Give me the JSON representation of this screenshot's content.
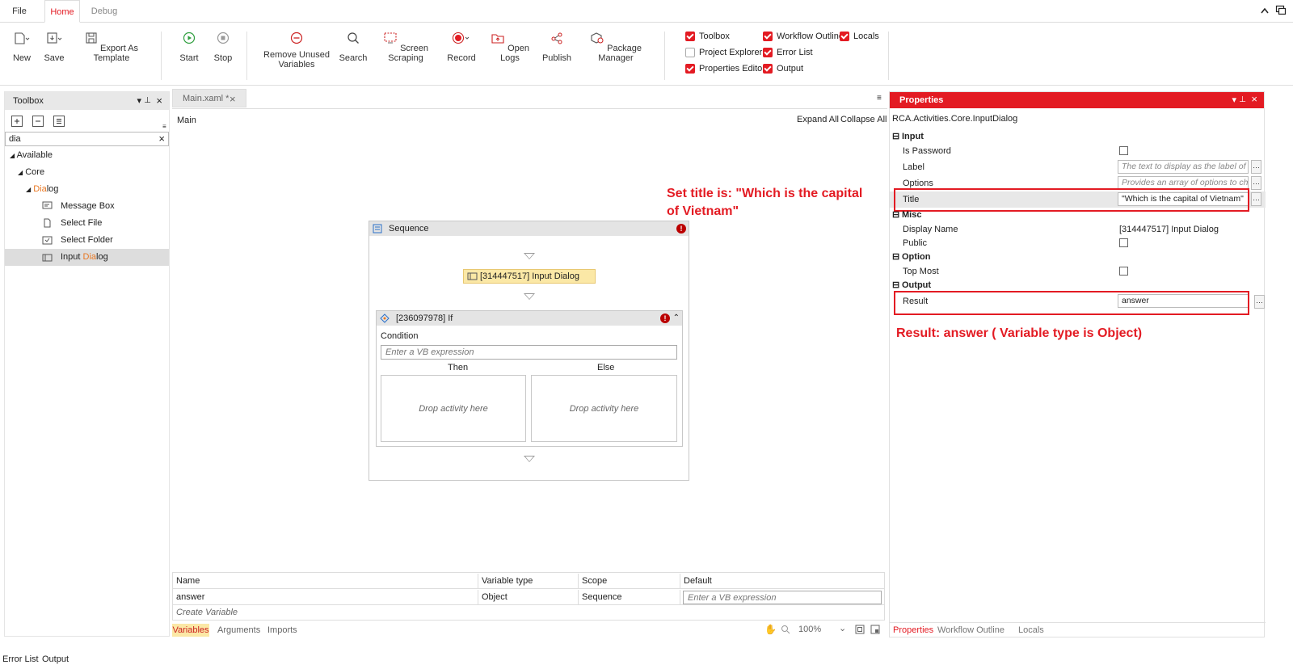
{
  "menu": {
    "file": "File",
    "home": "Home",
    "debug": "Debug"
  },
  "ribbon": {
    "new": "New",
    "save": "Save",
    "export": "Export As Template",
    "start": "Start",
    "stop": "Stop",
    "remove_unused_1": "Remove Unused",
    "remove_unused_2": "Variables",
    "search": "Search",
    "screen_scraping": "Screen Scraping",
    "record": "Record",
    "open_logs": "Open Logs",
    "publish": "Publish",
    "package_manager": "Package Manager"
  },
  "view_toggles": [
    {
      "label": "Toolbox",
      "checked": true
    },
    {
      "label": "Project Explorer",
      "checked": false
    },
    {
      "label": "Properties Editor",
      "checked": true
    },
    {
      "label": "Workflow Outline",
      "checked": true
    },
    {
      "label": "Error List",
      "checked": true
    },
    {
      "label": "Output",
      "checked": true
    },
    {
      "label": "Locals",
      "checked": true
    }
  ],
  "toolbox": {
    "title": "Toolbox",
    "search_value": "dia",
    "available": "Available",
    "core": "Core",
    "dialog_hl": "Dia",
    "dialog_rest": "log",
    "items": [
      "Message Box",
      "Select File",
      "Select Folder"
    ],
    "input_pre": "Input ",
    "input_hl": "Dia",
    "input_post": "log"
  },
  "designer": {
    "doc_tab": "Main.xaml *",
    "breadcrumb": "Main",
    "expand_all": "Expand All",
    "collapse_all": "Collapse All",
    "sequence": "Sequence",
    "input_dialog": "[314447517] Input Dialog",
    "if_title": "[236097978] If",
    "condition": "Condition",
    "condition_placeholder": "Enter a VB expression",
    "then": "Then",
    "else": "Else",
    "drop_then": "Drop activity here",
    "drop_else": "Drop activity here"
  },
  "variables": {
    "headers": [
      "Name",
      "Variable type",
      "Scope",
      "Default"
    ],
    "row": {
      "name": "answer",
      "type": "Object",
      "scope": "Sequence",
      "default_placeholder": "Enter a VB expression"
    },
    "create": "Create Variable",
    "tabs": [
      "Variables",
      "Arguments",
      "Imports"
    ],
    "zoom": "100%"
  },
  "properties": {
    "title": "Properties",
    "class": "RCA.Activities.Core.InputDialog",
    "cat_input": "Input",
    "is_password": "Is Password",
    "label": "Label",
    "label_placeholder": "The text to display as the label of the",
    "options": "Options",
    "options_placeholder": "Provides an array of options to choo",
    "title_label": "Title",
    "title_value": "\"Which is the capital of Vietnam\"",
    "cat_misc": "Misc",
    "display_name": "Display Name",
    "display_name_value": "[314447517] Input Dialog",
    "public": "Public",
    "cat_option": "Option",
    "top_most": "Top Most",
    "cat_output": "Output",
    "result": "Result",
    "result_value": "answer",
    "tabs": [
      "Properties",
      "Workflow Outline",
      "Locals"
    ]
  },
  "annotations": {
    "title_note_1": "Set title is: \"Which is the capital",
    "title_note_2": "of Vietnam\"",
    "result_note": "Result: answer ( Variable type is Object)"
  },
  "footer": {
    "error_list": "Error List",
    "output": "Output"
  },
  "colors": {
    "accent": "#e31b23",
    "highlight": "#e87722",
    "activity": "#fbe8a6"
  }
}
